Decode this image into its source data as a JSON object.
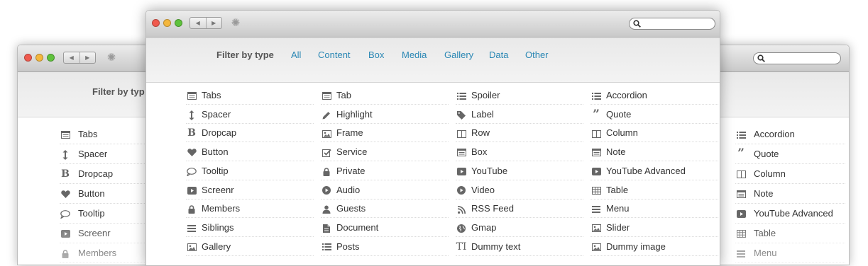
{
  "filter": {
    "label": "Filter by type",
    "back_label": "Filter by typ",
    "links": [
      "All",
      "Content",
      "Box",
      "Media",
      "Gallery",
      "Data",
      "Other"
    ]
  },
  "nav": {
    "back_arrow": "◀",
    "forward_arrow": "▶",
    "spinner": "✺"
  },
  "front_columns": [
    [
      {
        "label": "Tabs",
        "icon": "tabs"
      },
      {
        "label": "Spacer",
        "icon": "spacer"
      },
      {
        "label": "Dropcap",
        "icon": "dropcap"
      },
      {
        "label": "Button",
        "icon": "heart"
      },
      {
        "label": "Tooltip",
        "icon": "comment"
      },
      {
        "label": "Screenr",
        "icon": "play"
      },
      {
        "label": "Members",
        "icon": "lock"
      },
      {
        "label": "Siblings",
        "icon": "list"
      },
      {
        "label": "Gallery",
        "icon": "image"
      }
    ],
    [
      {
        "label": "Tab",
        "icon": "tabs"
      },
      {
        "label": "Highlight",
        "icon": "pencil"
      },
      {
        "label": "Frame",
        "icon": "image"
      },
      {
        "label": "Service",
        "icon": "check"
      },
      {
        "label": "Private",
        "icon": "lock"
      },
      {
        "label": "Audio",
        "icon": "play-circle"
      },
      {
        "label": "Guests",
        "icon": "user"
      },
      {
        "label": "Document",
        "icon": "document"
      },
      {
        "label": "Posts",
        "icon": "list-ul"
      }
    ],
    [
      {
        "label": "Spoiler",
        "icon": "list-ul"
      },
      {
        "label": "Label",
        "icon": "tag"
      },
      {
        "label": "Row",
        "icon": "columns"
      },
      {
        "label": "Box",
        "icon": "tabs"
      },
      {
        "label": "YouTube",
        "icon": "play"
      },
      {
        "label": "Video",
        "icon": "play-circle"
      },
      {
        "label": "RSS Feed",
        "icon": "rss"
      },
      {
        "label": "Gmap",
        "icon": "globe"
      },
      {
        "label": "Dummy text",
        "icon": "text"
      }
    ],
    [
      {
        "label": "Accordion",
        "icon": "list-ul"
      },
      {
        "label": "Quote",
        "icon": "quote"
      },
      {
        "label": "Column",
        "icon": "columns"
      },
      {
        "label": "Note",
        "icon": "tabs"
      },
      {
        "label": "YouTube Advanced",
        "icon": "play"
      },
      {
        "label": "Table",
        "icon": "table"
      },
      {
        "label": "Menu",
        "icon": "list"
      },
      {
        "label": "Slider",
        "icon": "image"
      },
      {
        "label": "Dummy image",
        "icon": "image"
      }
    ]
  ],
  "back_left": [
    {
      "label": "Tabs",
      "icon": "tabs"
    },
    {
      "label": "Spacer",
      "icon": "spacer"
    },
    {
      "label": "Dropcap",
      "icon": "dropcap"
    },
    {
      "label": "Button",
      "icon": "heart"
    },
    {
      "label": "Tooltip",
      "icon": "comment"
    },
    {
      "label": "Screenr",
      "icon": "play"
    },
    {
      "label": "Members",
      "icon": "lock"
    }
  ],
  "back_right": [
    {
      "label": "Accordion",
      "icon": "list-ul"
    },
    {
      "label": "Quote",
      "icon": "quote"
    },
    {
      "label": "Column",
      "icon": "columns"
    },
    {
      "label": "Note",
      "icon": "tabs"
    },
    {
      "label": "YouTube Advanced",
      "icon": "play"
    },
    {
      "label": "Table",
      "icon": "table"
    },
    {
      "label": "Menu",
      "icon": "list"
    }
  ],
  "colors": {
    "link": "#2a87b4",
    "icon": "#666666",
    "title_top": "#ececec",
    "title_bottom": "#c9c9c9"
  }
}
